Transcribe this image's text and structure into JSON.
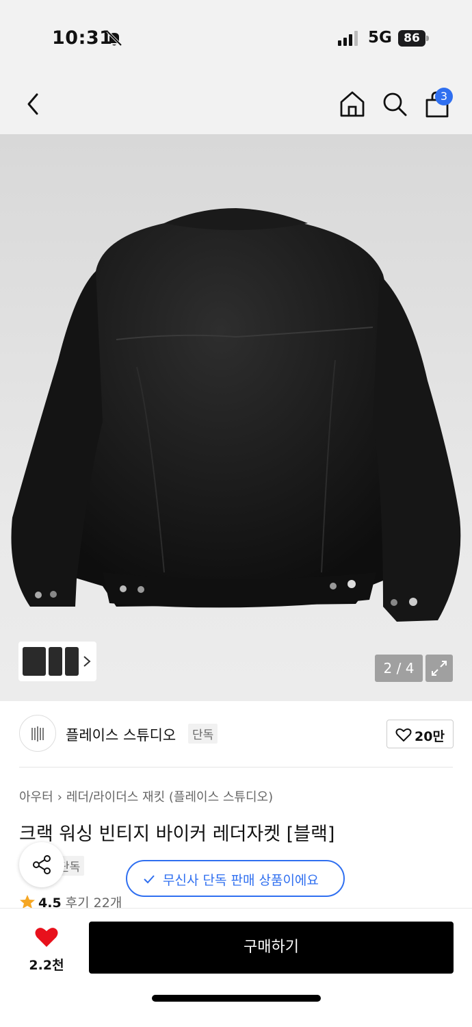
{
  "status": {
    "time": "10:31",
    "network": "5G",
    "battery": "86"
  },
  "nav": {
    "cart_count": "3"
  },
  "gallery": {
    "counter": "2 / 4"
  },
  "brand": {
    "name": "플레이스 스튜디오",
    "tag": "단독",
    "likes": "20만"
  },
  "product": {
    "category": [
      "아우터",
      "레더/라이더스 재킷 (플레이스 스튜디오)"
    ],
    "category_sep": "›",
    "title": "크랙 워싱 빈티지 바이커 레더자켓 [블랙]",
    "exclusive_tag": "단독",
    "exclusive_notice": "무신사 단독 판매 상품이에요",
    "rating": "4.5",
    "reviews": "후기 22개"
  },
  "bottom_bar": {
    "wish_count": "2.2천",
    "buy_label": "구매하기"
  },
  "colors": {
    "accent": "#2f6ff0",
    "heart": "#e8111c",
    "star": "#f5a623"
  }
}
